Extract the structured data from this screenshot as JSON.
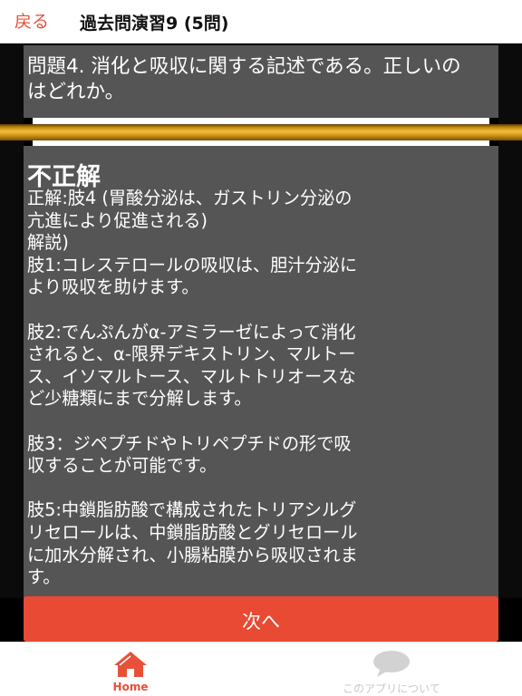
{
  "nav": {
    "back_label": "戻る",
    "title": "過去問演習9 (5問)"
  },
  "question": {
    "text": "問題4. 消化と吸収に関する記述である。正しいのはどれか。"
  },
  "answer": {
    "result": "不正解",
    "explanation": "正解:肢4 (胃酸分泌は、ガストリン分泌の\n亢進により促進される)\n解説)\n肢1:コレステロールの吸収は、胆汁分泌に\nより吸収を助けます。\n\n肢2:でんぷんがα-アミラーゼによって消化\nされると、α-限界デキストリン、マルトー\nス、イソマルトース、マルトトリオースな\nど少糖類にまで分解します。\n\n肢3：ジペプチドやトリペプチドの形で吸\n収することが可能です。\n\n肢5:中鎖脂肪酸で構成されたトリアシルグ\nリセロールは、中鎖脂肪酸とグリセロール\nに加水分解され、小腸粘膜から吸収されま\nす。"
  },
  "next_button": {
    "label": "次へ"
  },
  "tabs": [
    {
      "label": "Home",
      "icon": "home-icon",
      "active": true
    },
    {
      "label": "このアプリについて",
      "icon": "speech-bubble-icon",
      "active": false
    }
  ],
  "colors": {
    "accent": "#e8503a",
    "button": "#e84a33",
    "panel": "#555555",
    "gold": "#e0a825"
  }
}
